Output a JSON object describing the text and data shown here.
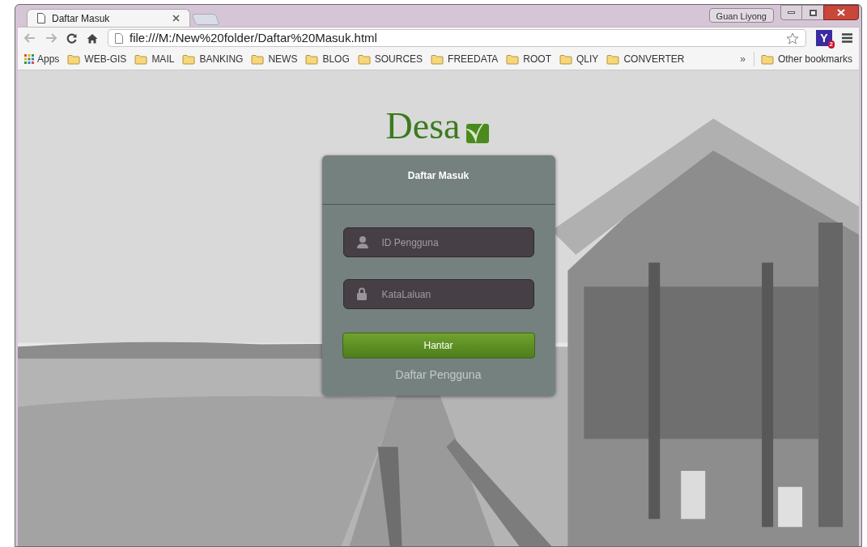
{
  "window": {
    "user": "Guan Liyong"
  },
  "tabs": [
    {
      "label": "Daftar Masuk",
      "selected": true
    }
  ],
  "address_bar": {
    "url": "file:///M:/New%20folder/Daftar%20Masuk.html"
  },
  "extension": {
    "letter": "Y",
    "badge": "2"
  },
  "bookmarks": {
    "apps": "Apps",
    "folders": [
      "WEB-GIS",
      "MAIL",
      "BANKING",
      "NEWS",
      "BLOG",
      "SOURCES",
      "FREEDATA",
      "ROOT",
      "QLIY",
      "CONVERTER"
    ],
    "overflow": "»",
    "other": "Other bookmarks"
  },
  "page": {
    "logo": "Desa",
    "login": {
      "title": "Daftar Masuk",
      "fields": [
        {
          "kind": "user",
          "placeholder": "ID Pengguna"
        },
        {
          "kind": "password",
          "placeholder": "KataLaluan"
        }
      ],
      "submit": "Hantar",
      "register_link": "Daftar Pengguna"
    }
  }
}
